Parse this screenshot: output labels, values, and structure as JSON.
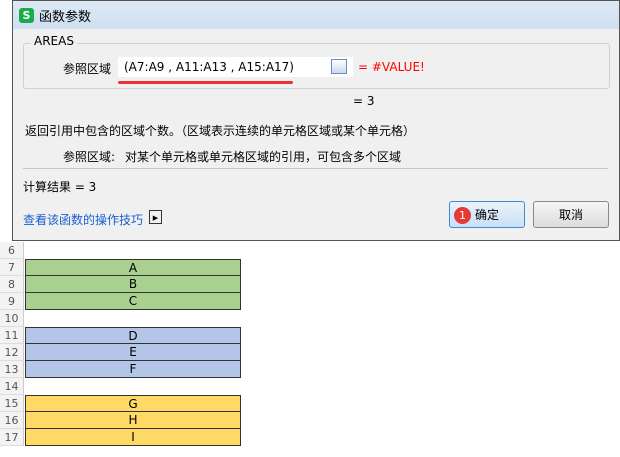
{
  "dialog": {
    "logo": "S",
    "title": "函数参数",
    "group_label": "AREAS",
    "field_label": "参照区域",
    "field_value": "(A7:A9 , A11:A13 , A15:A17)",
    "field_result": "= #VALUE!",
    "eval_result": "=  3",
    "description": "返回引用中包含的区域个数。（区域表示连续的单元格区域或某个单元格）",
    "param_desc_label": "参照区域:",
    "param_desc": "对某个单元格或单元格区域的引用，可包含多个区域",
    "calc_result": "计算结果  =  3",
    "help_link": "查看该函数的操作技巧",
    "ok_label": "确定",
    "cancel_label": "取消",
    "badge": "1",
    "error_color": "#ff0000"
  },
  "sheet": {
    "rows": [
      "6",
      "7",
      "8",
      "9",
      "10",
      "11",
      "12",
      "13",
      "14",
      "15",
      "16",
      "17"
    ],
    "cells": [
      {
        "row": "7",
        "v": "A",
        "color": "#a9d08e"
      },
      {
        "row": "8",
        "v": "B",
        "color": "#a9d08e"
      },
      {
        "row": "9",
        "v": "C",
        "color": "#a9d08e"
      },
      {
        "row": "11",
        "v": "D",
        "color": "#b4c6e7"
      },
      {
        "row": "12",
        "v": "E",
        "color": "#b4c6e7"
      },
      {
        "row": "13",
        "v": "F",
        "color": "#b4c6e7"
      },
      {
        "row": "15",
        "v": "G",
        "color": "#ffd966"
      },
      {
        "row": "16",
        "v": "H",
        "color": "#ffd966"
      },
      {
        "row": "17",
        "v": "I",
        "color": "#ffd966"
      }
    ]
  }
}
